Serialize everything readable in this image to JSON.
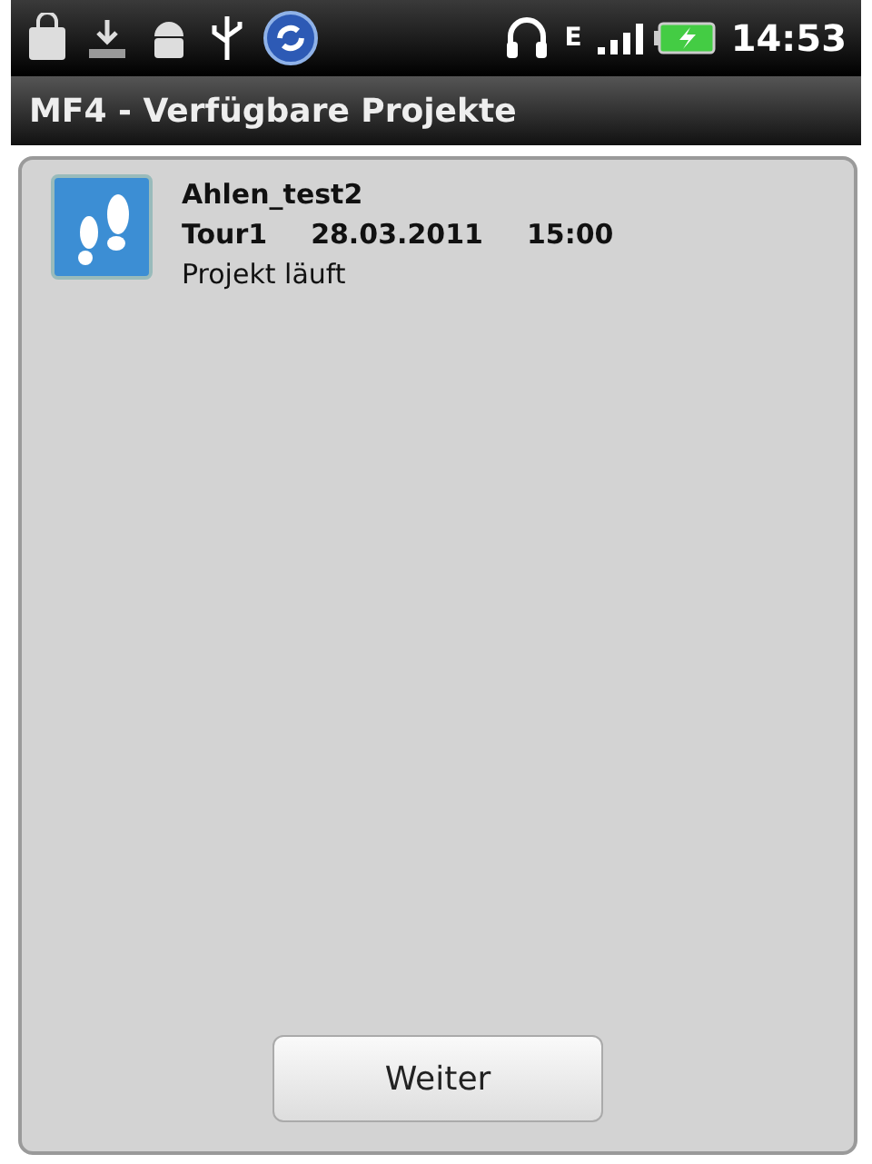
{
  "status_bar": {
    "network": "E",
    "time": "14:53"
  },
  "window": {
    "title": "MF4 - Verfügbare Projekte"
  },
  "projects": [
    {
      "name": "Ahlen_test2",
      "details": [
        "Tour1",
        "28.03.2011",
        "15:00"
      ],
      "status": "Projekt läuft"
    }
  ],
  "buttons": [
    "Weiter"
  ]
}
